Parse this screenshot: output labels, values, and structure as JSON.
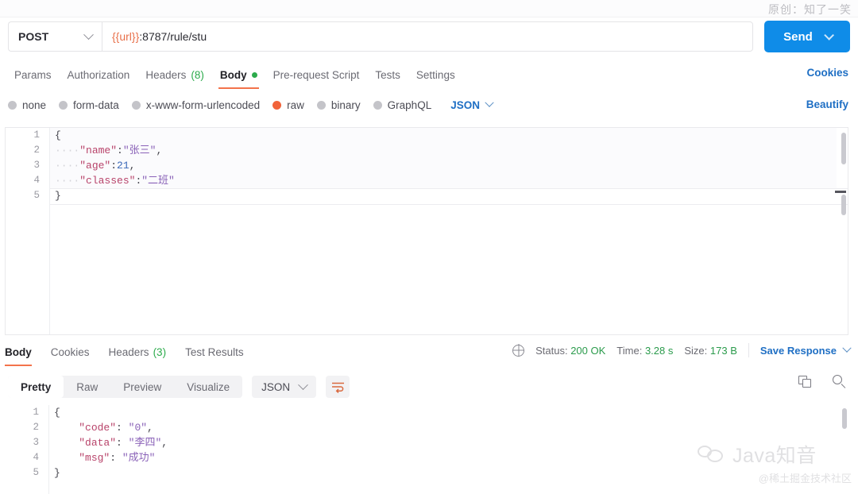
{
  "watermarks": {
    "top": "原创：知了一笑",
    "brand_title": "Java知音",
    "brand_sub": "@稀土掘金技术社区"
  },
  "request": {
    "method": "POST",
    "url_variable": "{{url}}",
    "url_rest": ":8787/rule/stu",
    "send_label": "Send",
    "tabs": [
      {
        "label": "Params",
        "badge": "",
        "active": false,
        "dot": false
      },
      {
        "label": "Authorization",
        "badge": "",
        "active": false,
        "dot": false
      },
      {
        "label": "Headers",
        "badge": "(8)",
        "active": false,
        "dot": false
      },
      {
        "label": "Body",
        "badge": "",
        "active": true,
        "dot": true
      },
      {
        "label": "Pre-request Script",
        "badge": "",
        "active": false,
        "dot": false
      },
      {
        "label": "Tests",
        "badge": "",
        "active": false,
        "dot": false
      },
      {
        "label": "Settings",
        "badge": "",
        "active": false,
        "dot": false
      }
    ],
    "cookies_link": "Cookies",
    "beautify_link": "Beautify",
    "body_types": [
      {
        "label": "none",
        "selected": false
      },
      {
        "label": "form-data",
        "selected": false
      },
      {
        "label": "x-www-form-urlencoded",
        "selected": false
      },
      {
        "label": "raw",
        "selected": true
      },
      {
        "label": "binary",
        "selected": false
      },
      {
        "label": "GraphQL",
        "selected": false
      }
    ],
    "raw_format": "JSON",
    "body_lines": [
      {
        "n": "1",
        "segments": [
          {
            "t": "{",
            "c": "p"
          }
        ]
      },
      {
        "n": "2",
        "segments": [
          {
            "t": "····",
            "c": "dots"
          },
          {
            "t": "\"name\"",
            "c": "k"
          },
          {
            "t": ":",
            "c": "p"
          },
          {
            "t": "\"张三\"",
            "c": "s"
          },
          {
            "t": ",",
            "c": "p"
          }
        ]
      },
      {
        "n": "3",
        "segments": [
          {
            "t": "····",
            "c": "dots"
          },
          {
            "t": "\"age\"",
            "c": "k"
          },
          {
            "t": ":",
            "c": "p"
          },
          {
            "t": "21",
            "c": "n"
          },
          {
            "t": ",",
            "c": "p"
          }
        ]
      },
      {
        "n": "4",
        "segments": [
          {
            "t": "····",
            "c": "dots"
          },
          {
            "t": "\"classes\"",
            "c": "k"
          },
          {
            "t": ":",
            "c": "p"
          },
          {
            "t": "\"二班\"",
            "c": "s"
          }
        ]
      },
      {
        "n": "5",
        "segments": [
          {
            "t": "}",
            "c": "p"
          }
        ]
      }
    ]
  },
  "response": {
    "tabs": [
      {
        "label": "Body",
        "badge": "",
        "active": true
      },
      {
        "label": "Cookies",
        "badge": "",
        "active": false
      },
      {
        "label": "Headers",
        "badge": "(3)",
        "active": false
      },
      {
        "label": "Test Results",
        "badge": "",
        "active": false
      }
    ],
    "status_label": "Status:",
    "status_value": "200 OK",
    "time_label": "Time:",
    "time_value": "3.28 s",
    "size_label": "Size:",
    "size_value": "173 B",
    "save_response": "Save Response",
    "view_modes": [
      {
        "label": "Pretty",
        "active": true
      },
      {
        "label": "Raw",
        "active": false
      },
      {
        "label": "Preview",
        "active": false
      },
      {
        "label": "Visualize",
        "active": false
      }
    ],
    "format": "JSON",
    "body_lines": [
      {
        "n": "1",
        "segments": [
          {
            "t": "{",
            "c": "p"
          }
        ]
      },
      {
        "n": "2",
        "segments": [
          {
            "t": "    ",
            "c": "p"
          },
          {
            "t": "\"code\"",
            "c": "k"
          },
          {
            "t": ": ",
            "c": "p"
          },
          {
            "t": "\"0\"",
            "c": "s"
          },
          {
            "t": ",",
            "c": "p"
          }
        ]
      },
      {
        "n": "3",
        "segments": [
          {
            "t": "    ",
            "c": "p"
          },
          {
            "t": "\"data\"",
            "c": "k"
          },
          {
            "t": ": ",
            "c": "p"
          },
          {
            "t": "\"李四\"",
            "c": "s"
          },
          {
            "t": ",",
            "c": "p"
          }
        ]
      },
      {
        "n": "4",
        "segments": [
          {
            "t": "    ",
            "c": "p"
          },
          {
            "t": "\"msg\"",
            "c": "k"
          },
          {
            "t": ": ",
            "c": "p"
          },
          {
            "t": "\"成功\"",
            "c": "s"
          }
        ]
      },
      {
        "n": "5",
        "segments": [
          {
            "t": "}",
            "c": "p"
          }
        ]
      }
    ]
  },
  "colors": {
    "send_blue": "#0f8ce8",
    "accent_orange": "#f3734b",
    "link_blue": "#1f6fc4",
    "status_green": "#2b9b4c"
  }
}
